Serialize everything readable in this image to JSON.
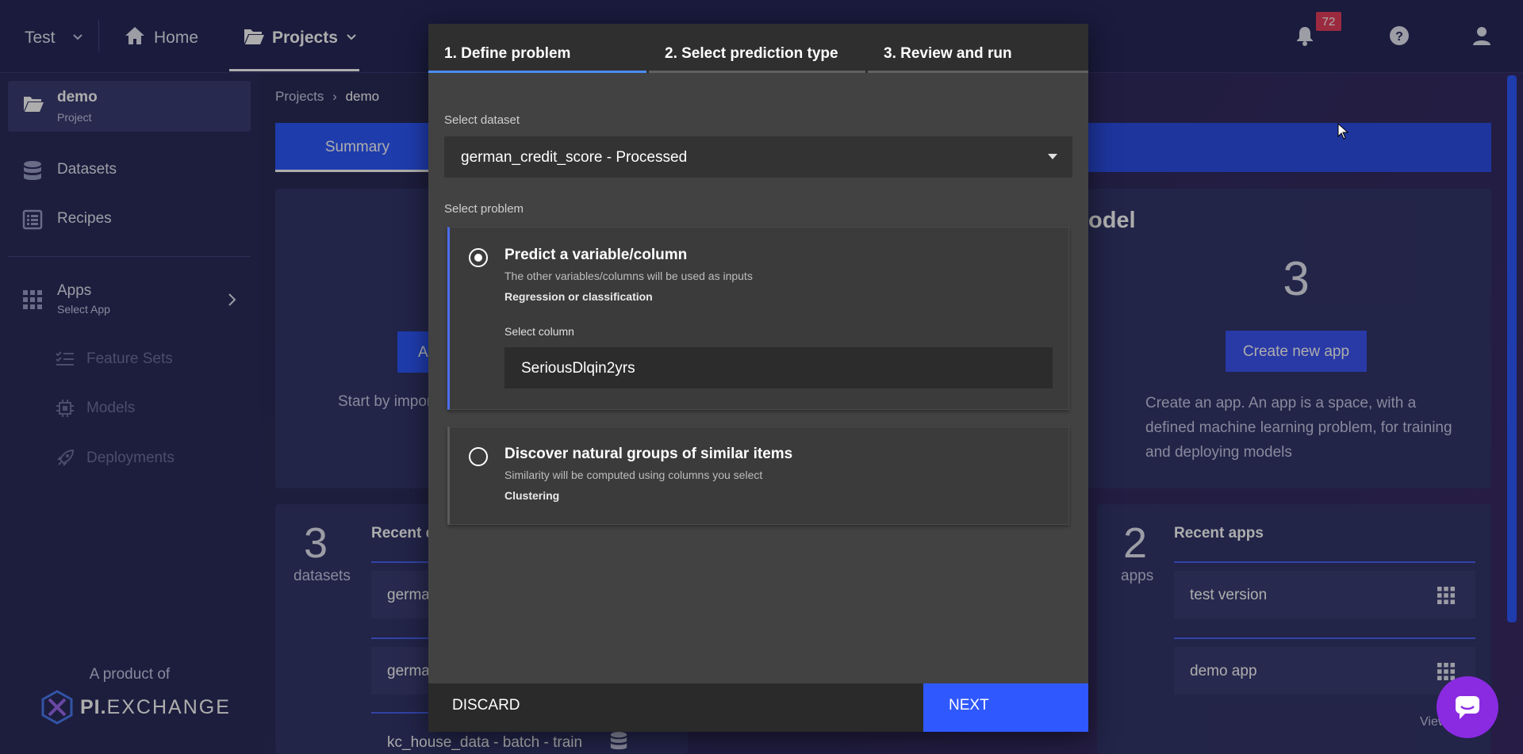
{
  "topbar": {
    "workspace": "Test",
    "home": "Home",
    "projects": "Projects",
    "notification_count": "72"
  },
  "sidebar": {
    "project_name": "demo",
    "project_sub": "Project",
    "datasets": "Datasets",
    "recipes": "Recipes",
    "apps": "Apps",
    "apps_sub": "Select App",
    "feature_sets": "Feature Sets",
    "models": "Models",
    "deployments": "Deployments",
    "product_of": "A product of",
    "brand_pi": "PI.",
    "brand_exchange": "EXCHANGE"
  },
  "breadcrumb": {
    "projects": "Projects",
    "current": "demo"
  },
  "background": {
    "summary_tab": "Summary",
    "button_partial": "A",
    "start_text": "Start by impor",
    "model_partial": "odel",
    "apps_count": "3",
    "create_app": "Create new app",
    "create_desc": "Create an app. An app is a space, with a defined machine learning problem, for training and deploying models",
    "datasets_count": "3",
    "datasets_word": "datasets",
    "recent_datasets_partial": "Recent d",
    "dataset_items": [
      "germa",
      "germa",
      "kc_house_data - batch - train"
    ],
    "apps_num": "2",
    "apps_word": "apps",
    "recent_apps": "Recent apps",
    "app_items": [
      "test version",
      "demo app"
    ],
    "view_partial": "View"
  },
  "modal": {
    "tabs": [
      "1. Define problem",
      "2. Select prediction type",
      "3. Review and run"
    ],
    "select_dataset_label": "Select dataset",
    "dataset_value": "german_credit_score - Processed",
    "select_problem_label": "Select problem",
    "option1": {
      "title": "Predict a variable/column",
      "desc": "The other variables/columns will be used as inputs",
      "type": "Regression or classification",
      "select_column_label": "Select column",
      "column_value": "SeriousDlqin2yrs"
    },
    "option2": {
      "title": "Discover natural groups of similar items",
      "desc": "Similarity will be computed using columns you select",
      "type": "Clustering"
    },
    "discard": "DISCARD",
    "next": "NEXT"
  }
}
